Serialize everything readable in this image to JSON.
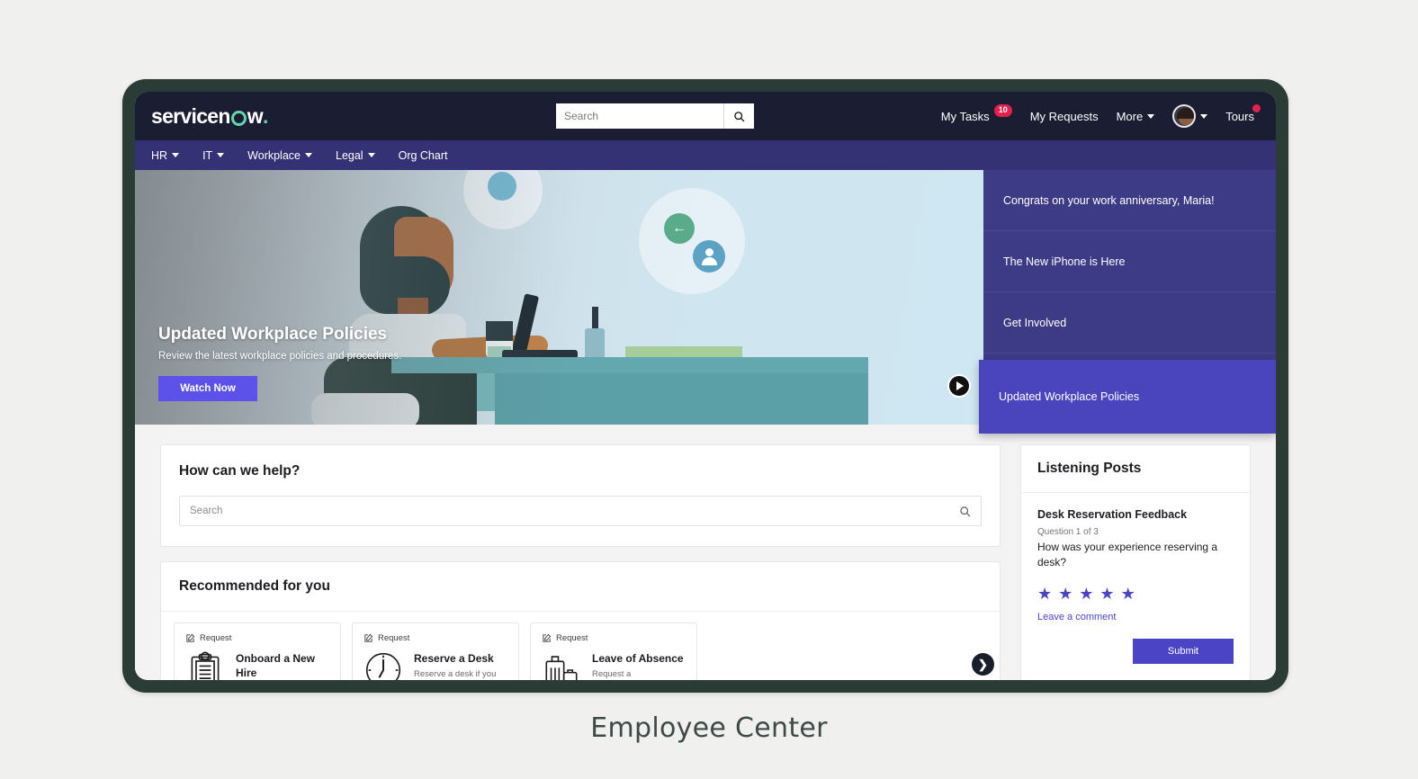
{
  "caption": "Employee Center",
  "header": {
    "logo_text_1": "servicen",
    "logo_text_2": "w",
    "logo_dot": ".",
    "search_placeholder": "Search",
    "search_value": "",
    "search_icon": "search-icon",
    "my_tasks_label": "My Tasks",
    "my_tasks_badge": "10",
    "my_requests_label": "My Requests",
    "more_label": "More",
    "tours_label": "Tours"
  },
  "nav": {
    "items": [
      {
        "label": "HR",
        "has_caret": true
      },
      {
        "label": "IT",
        "has_caret": true
      },
      {
        "label": "Workplace",
        "has_caret": true
      },
      {
        "label": "Legal",
        "has_caret": true
      },
      {
        "label": "Org Chart",
        "has_caret": false
      }
    ]
  },
  "hero": {
    "title": "Updated Workplace Policies",
    "subtitle": "Review the latest workplace policies and procedures.",
    "button_label": "Watch Now",
    "play_icon": "play-icon"
  },
  "announcements": {
    "items": [
      {
        "label": "Congrats on your work anniversary, Maria!",
        "active": false
      },
      {
        "label": "The New iPhone is Here",
        "active": false
      },
      {
        "label": "Get Involved",
        "active": false
      },
      {
        "label": "Updated Workplace Policies",
        "active": true
      }
    ]
  },
  "help": {
    "title": "How can we help?",
    "search_placeholder": "Search",
    "search_value": "",
    "search_icon": "search-icon"
  },
  "recommended": {
    "title": "Recommended for you",
    "next_label": "❯",
    "cards": [
      {
        "type": "Request",
        "type_icon": "request-edit-icon",
        "icon": "clipboard-icon",
        "name": "Onboard a New Hire",
        "desc": ""
      },
      {
        "type": "Request",
        "type_icon": "request-edit-icon",
        "icon": "clock-icon",
        "name": "Reserve a Desk",
        "desc": "Reserve a desk if you are"
      },
      {
        "type": "Request",
        "type_icon": "request-edit-icon",
        "icon": "luggage-icon",
        "name": "Leave of Absence",
        "desc": "Request a"
      }
    ]
  },
  "listening_posts": {
    "title": "Listening Posts",
    "survey_name": "Desk Reservation Feedback",
    "question_number": "Question 1 of 3",
    "question": "How was your experience reserving a desk?",
    "stars": [
      "★",
      "★",
      "★",
      "★",
      "★"
    ],
    "comment_link": "Leave a comment",
    "submit_label": "Submit"
  },
  "colors": {
    "header_bg": "#1b1d33",
    "nav_bg": "#353175",
    "announce_bg": "#3e3b86",
    "announce_active": "#4b45bd",
    "accent": "#4b45c6",
    "hero_button": "#5c51e8",
    "badge_red": "#e0224d",
    "brand_green": "#62d6ac",
    "frame": "#2b3c37",
    "page_bg": "#f0f0ef"
  }
}
